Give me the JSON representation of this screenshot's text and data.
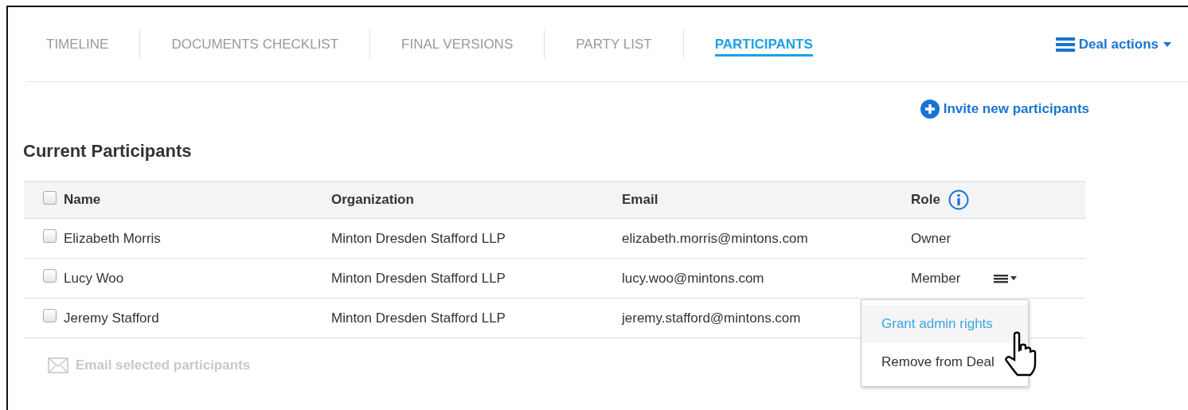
{
  "tabs": [
    {
      "label": "TIMELINE",
      "selected": false
    },
    {
      "label": "DOCUMENTS CHECKLIST",
      "selected": false
    },
    {
      "label": "FINAL VERSIONS",
      "selected": false
    },
    {
      "label": "PARTY LIST",
      "selected": false
    },
    {
      "label": "PARTICIPANTS",
      "selected": true
    }
  ],
  "deal_actions": {
    "label": "Deal actions"
  },
  "invite": {
    "label": "Invite new participants"
  },
  "section_title": "Current Participants",
  "table": {
    "select_all": {
      "checked": false
    },
    "columns": [
      "Name",
      "Organization",
      "Email",
      "Role"
    ],
    "rows": [
      {
        "checked": false,
        "name": "Elizabeth Morris",
        "organization": "Minton Dresden Stafford LLP",
        "email": "elizabeth.morris@mintons.com",
        "role": "Owner",
        "row_menu": false
      },
      {
        "checked": false,
        "name": "Lucy Woo",
        "organization": "Minton Dresden Stafford LLP",
        "email": "lucy.woo@mintons.com",
        "role": "Member",
        "row_menu": true
      },
      {
        "checked": false,
        "name": "Jeremy Stafford",
        "organization": "Minton Dresden Stafford LLP",
        "email": "jeremy.stafford@mintons.com",
        "row_menu": false
      }
    ]
  },
  "row_menu": {
    "items": [
      {
        "label": "Grant admin rights",
        "highlighted": true
      },
      {
        "label": "Remove from Deal",
        "highlighted": false
      }
    ]
  },
  "email_selected": {
    "label": "Email selected participants",
    "disabled": true
  }
}
